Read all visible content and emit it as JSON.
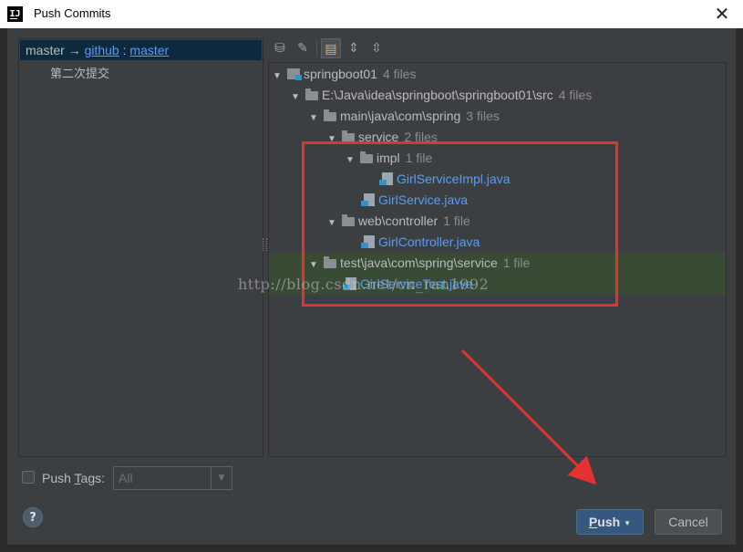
{
  "window": {
    "title": "Push Commits",
    "app_icon_label": "IJ",
    "close_glyph": "✕"
  },
  "commits": {
    "branch_local": "master",
    "branch_arrow": "→",
    "remote": "github",
    "separator": ":",
    "remote_branch": "master",
    "message": "第二次提交"
  },
  "toolbar": {
    "icons": [
      "branch-icon",
      "edit-icon",
      "group-by-directory-icon",
      "expand-all-icon",
      "collapse-all-icon"
    ]
  },
  "tree": {
    "rows": [
      {
        "name": "springboot01",
        "count": "4 files",
        "kind": "module"
      },
      {
        "name": "E:\\Java\\idea\\springboot\\springboot01\\src",
        "count": "4 files",
        "kind": "folder"
      },
      {
        "name": "main\\java\\com\\spring",
        "count": "3 files",
        "kind": "folder"
      },
      {
        "name": "service",
        "count": "2 files",
        "kind": "folder"
      },
      {
        "name": "impl",
        "count": "1 file",
        "kind": "folder"
      },
      {
        "name": "GirlServiceImpl.java",
        "count": "",
        "kind": "file"
      },
      {
        "name": "GirlService.java",
        "count": "",
        "kind": "file"
      },
      {
        "name": "web\\controller",
        "count": "1 file",
        "kind": "folder"
      },
      {
        "name": "GirlController.java",
        "count": "",
        "kind": "file"
      },
      {
        "name": "test\\java\\com\\spring\\service",
        "count": "1 file",
        "kind": "folder"
      },
      {
        "name": "GirlServiceTest.java",
        "count": "",
        "kind": "file"
      }
    ]
  },
  "watermark": "http://blog.csdn.net/cn_ran1992",
  "footer": {
    "push_tags_prefix": "Push ",
    "push_tags_mnemonic": "T",
    "push_tags_rest": "ags:",
    "tags_value": "All",
    "help_label": "?",
    "push_mnemonic": "P",
    "push_rest": "ush",
    "cancel_label": "Cancel"
  },
  "colors": {
    "accent_link": "#589df6",
    "annotation_red": "#e63131",
    "primary_button": "#365880"
  }
}
